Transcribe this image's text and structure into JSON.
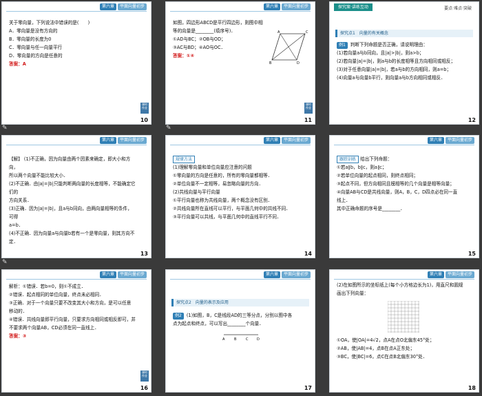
{
  "header": {
    "chapter": "第六章",
    "section": "平面向量初步"
  },
  "corner_text": "课时 作业",
  "slides": [
    {
      "page": "10",
      "lines": [
        "关于零向量，下列说法中错误的是(　　)",
        "A．零向量是没有方向的",
        "B．零向量的长度为0",
        "C．零向量与任一向量平行",
        "D．零向量的方向是任意的"
      ],
      "answer": "答案：A"
    },
    {
      "page": "11",
      "lines": [
        "如图，四边形ABCD是平行四边形，则图中相",
        "等的向量是________(填序号)．",
        "①AD与BC；②OB与OD；",
        "③AC与BD；④AO与OC．"
      ],
      "answer": "答案：①④",
      "fig_labels": [
        "A",
        "B",
        "C",
        "D",
        "O"
      ]
    },
    {
      "page": "12",
      "top_tag": "探究案·讲练互动",
      "top_sub": "要点·难点·突破",
      "band": "探究点1　向量的有关概念",
      "ex": "例1",
      "lines": [
        "判断下列命题是否正确，请说明理由：",
        "(1)若向量a与b同向，且|a|>|b|，则a>b；",
        "(2)若向量|a|=|b|，则a与b的长度相等且方向相同或相反；",
        "(3)对于任意向量|a|=|b|，若a与b的方向相同，则a=b；",
        "(4)向量a与向量b平行，则向量a与b方向相同或相反．"
      ]
    },
    {
      "page": "13",
      "tag": "【解】",
      "lines": [
        "(1)不正确，因为向量由两个因素来确定，即大小和方向，",
        "所以两个向量不能比较大小．",
        "(2)不正确．由|a|=|b|只能判断两向量的长度相等，不能确定它们的",
        "方向关系．",
        "(3)正确．因为|a|=|b|，且a与b同向，由两向量相等的条件，可得",
        "a=b．",
        "(4)不正确．因为向量a与向量b若有一个是零向量，则其方向不定．"
      ]
    },
    {
      "page": "14",
      "title": "规律方法",
      "lines": [
        "(1)理解零向量和单位向量应注意的问题",
        "①零向量的方向是任意的，所有的零向量都相等．",
        "②单位向量不一定相等，易忽略向量的方向．",
        "(2)共线向量与平行向量",
        "①平行向量也称为共线向量，两个概念没有区别．",
        "②共线向量所在直线可以平行，与平面几何中的共线不同．",
        "③平行向量可以共线，与平面几何中的直线平行不同．"
      ]
    },
    {
      "page": "15",
      "title": "跟踪训练",
      "lines": [
        "给出下列命题：",
        "①若a∥b，b∥c，则a∥c；",
        "②若单位向量的起点相同，则终点相同；",
        "③起点不同，但方向相同且模相等的几个向量是相等向量；",
        "④向量AB与CD是共线向量，则A，B，C，D四点必在同一直",
        "线上．",
        "其中正确命题的序号是________．"
      ]
    },
    {
      "page": "16",
      "lines": [
        "解析：①错误．若b=0，则①不成立．",
        "②错误．起点相同的单位向量，终点未必相同．",
        "③正确．对于一个向量只要不改变其大小和方向，是可以任意",
        "移动的．",
        "④错误．共线向量即平行向量，只要求方向相同或相反即可，并",
        "不要求两个向量AB，CD必须在同一直线上．"
      ],
      "answer": "答案：③"
    },
    {
      "page": "17",
      "band": "探究点2　向量的表示及应用",
      "ex": "例2",
      "lines": [
        "(1)如图，B，C是线段AD的三等分点，分别以图中各",
        "点为起点和终点，可以写出________个向量．"
      ],
      "fig_labels": [
        "A",
        "B",
        "C",
        "D"
      ]
    },
    {
      "page": "18",
      "lines": [
        "(2)在如图所示的坐标纸上(每个小方格边长为1)，用直尺和圆规",
        "画出下列向量："
      ],
      "items": [
        "①OA，使|OA|=4√2，点A在点O北偏东45°处；",
        "②AB，使|AB|=4，点B在点A正东处；",
        "③BC，使|BC|=6，点C在点B北偏东30°处．"
      ]
    }
  ]
}
